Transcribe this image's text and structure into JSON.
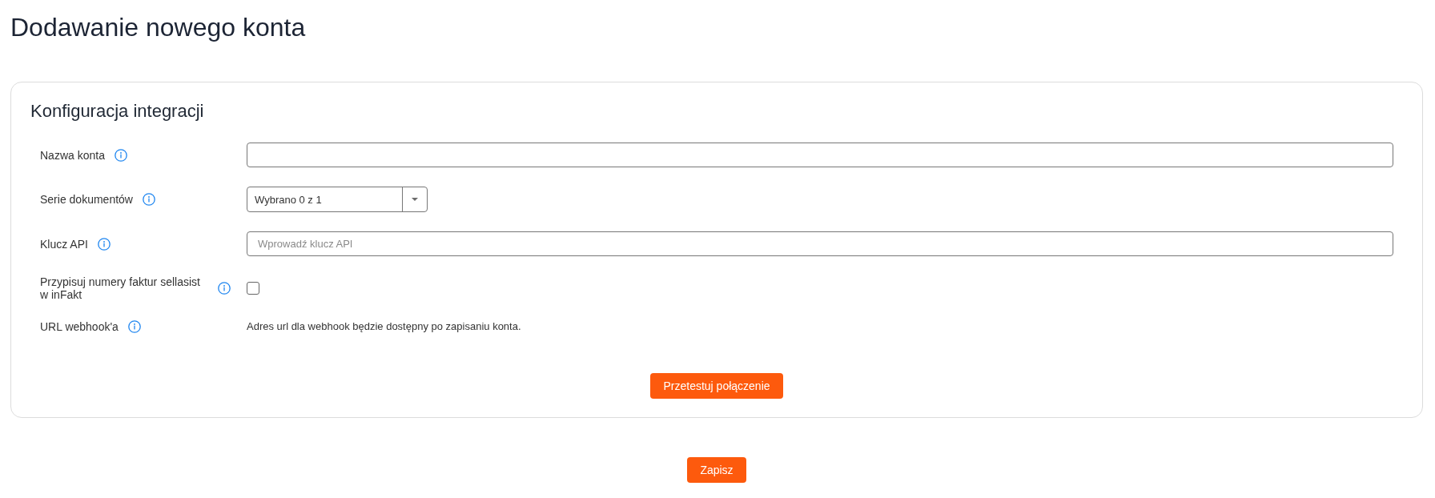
{
  "page_title": "Dodawanie nowego konta",
  "integration_card": {
    "heading": "Konfiguracja integracji",
    "fields": [
      {
        "kind": "text",
        "label": "Nazwa konta"
      },
      {
        "kind": "select",
        "label": "Serie dokumentów",
        "value": "Wybrano 0 z 1"
      },
      {
        "kind": "text",
        "label": "Klucz API",
        "placeholder": "Wprowadź klucz API"
      },
      {
        "kind": "checkbox",
        "label": "Przypisuj numery faktur sellasist w inFakt",
        "checked": false
      },
      {
        "kind": "note",
        "label": "URL webhook'a",
        "text": "Adres url dla webhook będzie dostępny po zapisaniu konta."
      }
    ],
    "test_button": "Przetestuj połączenie"
  },
  "save_button": "Zapisz"
}
